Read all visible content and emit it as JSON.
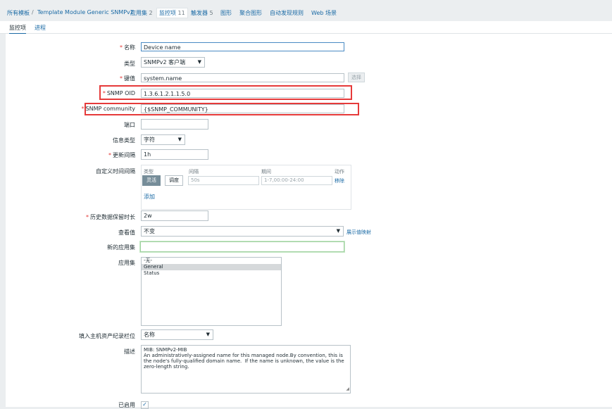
{
  "breadcrumb": {
    "all_templates": "所有模板",
    "separator": "/",
    "template": "Template Module Generic SNMPv2",
    "applications": {
      "label": "应用集",
      "count": "2"
    },
    "items": {
      "label": "监控项",
      "count": "11"
    },
    "triggers": {
      "label": "触发器",
      "count": "5"
    },
    "graphs": "图形",
    "screens": "聚合图形",
    "discovery": "自动发现规则",
    "web": "Web 场景"
  },
  "tabs": {
    "item": "监控项",
    "process": "进程"
  },
  "form": {
    "name": {
      "label": "名称",
      "value": "Device name"
    },
    "type": {
      "label": "类型",
      "value": "SNMPv2 客户端"
    },
    "key": {
      "label": "键值",
      "value": "system.name",
      "button": "选择"
    },
    "snmp_oid": {
      "label": "SNMP OID",
      "value": "1.3.6.1.2.1.1.5.0"
    },
    "snmp_community": {
      "label": "SNMP community",
      "value": "{$SNMP_COMMUNITY}"
    },
    "port": {
      "label": "端口",
      "value": ""
    },
    "info_type": {
      "label": "信息类型",
      "value": "字符"
    },
    "update_interval": {
      "label": "更新间隔",
      "value": "1h"
    },
    "custom_intervals": {
      "label": "自定义时间间隔",
      "headers": {
        "type": "类型",
        "interval": "间隔",
        "period": "期间",
        "action": "动作"
      },
      "flexible": "灵活",
      "scheduling": "调度",
      "interval_placeholder": "50s",
      "period_placeholder": "1-7,00:00-24:00",
      "remove": "移除",
      "add": "添加"
    },
    "history": {
      "label": "历史数据保留时长",
      "value": "2w"
    },
    "show_value": {
      "label": "查看值",
      "value": "不变",
      "link": "展示值映射"
    },
    "new_application": {
      "label": "新的应用集",
      "value": ""
    },
    "applications": {
      "label": "应用集",
      "options": [
        "-无-",
        "General",
        "Status"
      ],
      "selected": "General"
    },
    "inventory": {
      "label": "填入主机资产纪录栏位",
      "value": "名称"
    },
    "description": {
      "label": "描述",
      "value": "MIB: SNMPv2-MIB\nAn administratively-assigned name for this managed node.By convention, this is the node's fully-qualified domain name.  If the name is unknown, the value is the zero-length string."
    },
    "enabled": {
      "label": "已启用",
      "checked": true
    }
  },
  "colors": {
    "link": "#1a6aa5",
    "required": "#e33734",
    "highlight": "#e63a3a"
  }
}
